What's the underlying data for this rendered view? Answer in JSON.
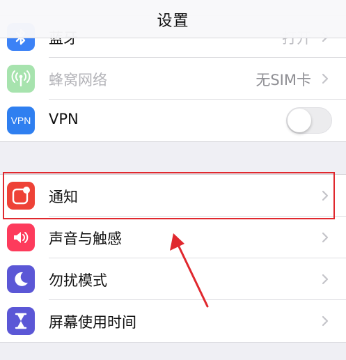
{
  "navbar": {
    "title": "设置"
  },
  "group1": {
    "rows": [
      {
        "label": "蓝牙",
        "value": "打开",
        "icon": "bluetooth-icon"
      },
      {
        "label": "蜂窝网络",
        "value": "无SIM卡",
        "icon": "cellular-antenna-icon"
      },
      {
        "label": "VPN",
        "icon_text": "VPN",
        "toggle": false
      }
    ]
  },
  "group2": {
    "rows": [
      {
        "label": "通知",
        "icon": "notifications-icon",
        "icon_color": "#ee4237"
      },
      {
        "label": "声音与触感",
        "icon": "speaker-icon",
        "icon_color": "#fd3b5c"
      },
      {
        "label": "勿扰模式",
        "icon": "moon-icon",
        "icon_color": "#5b57d6"
      },
      {
        "label": "屏幕使用时间",
        "icon": "hourglass-icon",
        "icon_color": "#5b57d6"
      }
    ]
  },
  "colors": {
    "highlight_box": "#e0282e",
    "annotation_arrow": "#e0282e",
    "bluetooth_icon": "#3c82f6",
    "cellular_icon": "#a7e3ae",
    "vpn_icon": "#2f7ff0"
  }
}
